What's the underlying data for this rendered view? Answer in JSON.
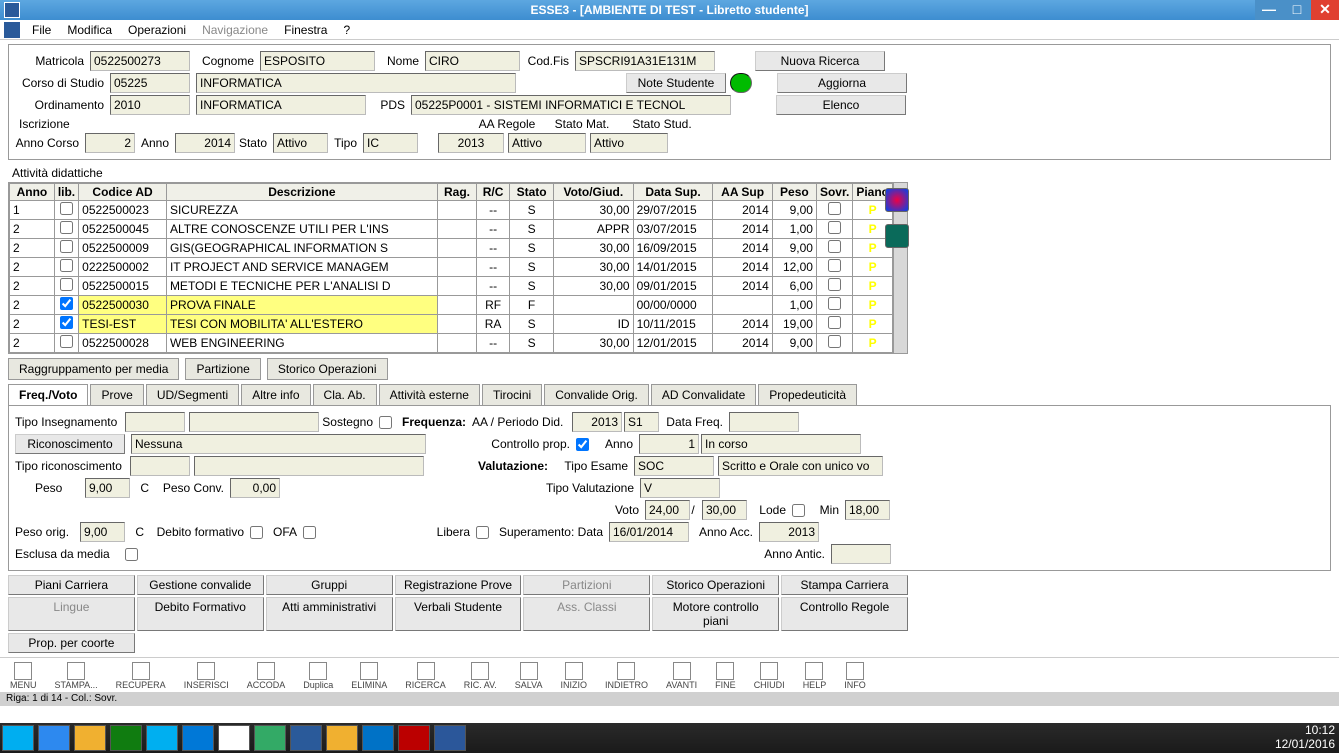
{
  "window": {
    "title": "ESSE3 - [AMBIENTE DI TEST - Libretto studente]"
  },
  "menu": {
    "file": "File",
    "modifica": "Modifica",
    "operazioni": "Operazioni",
    "navigazione": "Navigazione",
    "finestra": "Finestra",
    "help": "?"
  },
  "header": {
    "matricola_lbl": "Matricola",
    "matricola": "0522500273",
    "cognome_lbl": "Cognome",
    "cognome": "ESPOSITO",
    "nome_lbl": "Nome",
    "nome": "CIRO",
    "codfis_lbl": "Cod.Fis",
    "codfis": "SPSCRI91A31E131M",
    "corso_lbl": "Corso di Studio",
    "corso_cod": "05225",
    "corso_desc": "INFORMATICA",
    "note_btn": "Note Studente",
    "ord_lbl": "Ordinamento",
    "ord": "2010",
    "ord_desc": "INFORMATICA",
    "pds_lbl": "PDS",
    "pds": "05225P0001 - SISTEMI INFORMATICI E TECNOL",
    "iscr_lbl": "Iscrizione",
    "anno_corso_lbl": "Anno Corso",
    "anno_corso": "2",
    "anno_lbl": "Anno",
    "anno": "2014",
    "stato_lbl": "Stato",
    "stato": "Attivo",
    "tipo_lbl": "Tipo",
    "tipo": "IC",
    "aa_regole_lbl": "AA Regole",
    "aa_regole": "2013",
    "stato_mat_lbl": "Stato Mat.",
    "stato_mat": "Attivo",
    "stato_stud_lbl": "Stato Stud.",
    "stato_stud": "Attivo",
    "btn_ricerca": "Nuova Ricerca",
    "btn_aggiorna": "Aggiorna",
    "btn_elenco": "Elenco"
  },
  "grid": {
    "title": "Attività didattiche",
    "cols": {
      "anno": "Anno",
      "lib": "lib.",
      "codice": "Codice AD",
      "descr": "Descrizione",
      "rag": "Rag.",
      "rc": "R/C",
      "stato": "Stato",
      "voto": "Voto/Giud.",
      "data": "Data Sup.",
      "aasup": "AA Sup",
      "peso": "Peso",
      "sovr": "Sovr.",
      "piano": "Piano"
    },
    "rows": [
      {
        "anno": "1",
        "cb": false,
        "codice": "0522500023",
        "descr": "SICUREZZA",
        "rag": "",
        "rc": "--",
        "stato": "S",
        "voto": "30,00",
        "data": "29/07/2015",
        "aasup": "2014",
        "peso": "9,00",
        "hl": false
      },
      {
        "anno": "2",
        "cb": false,
        "codice": "0522500045",
        "descr": "ALTRE CONOSCENZE UTILI PER L'INS",
        "rag": "",
        "rc": "--",
        "stato": "S",
        "voto": "APPR",
        "data": "03/07/2015",
        "aasup": "2014",
        "peso": "1,00",
        "hl": false
      },
      {
        "anno": "2",
        "cb": false,
        "codice": "0522500009",
        "descr": "GIS(GEOGRAPHICAL INFORMATION S",
        "rag": "",
        "rc": "--",
        "stato": "S",
        "voto": "30,00",
        "data": "16/09/2015",
        "aasup": "2014",
        "peso": "9,00",
        "hl": false
      },
      {
        "anno": "2",
        "cb": false,
        "codice": "0222500002",
        "descr": "IT PROJECT AND SERVICE MANAGEM",
        "rag": "",
        "rc": "--",
        "stato": "S",
        "voto": "30,00",
        "data": "14/01/2015",
        "aasup": "2014",
        "peso": "12,00",
        "hl": false
      },
      {
        "anno": "2",
        "cb": false,
        "codice": "0522500015",
        "descr": "METODI E TECNICHE PER L'ANALISI D",
        "rag": "",
        "rc": "--",
        "stato": "S",
        "voto": "30,00",
        "data": "09/01/2015",
        "aasup": "2014",
        "peso": "6,00",
        "hl": false
      },
      {
        "anno": "2",
        "cb": true,
        "codice": "0522500030",
        "descr": "PROVA FINALE",
        "rag": "",
        "rc": "RF",
        "stato": "F",
        "voto": "",
        "data": "00/00/0000",
        "aasup": "",
        "peso": "1,00",
        "hl": true
      },
      {
        "anno": "2",
        "cb": true,
        "codice": "TESI-EST",
        "descr": "TESI CON MOBILITA' ALL'ESTERO",
        "rag": "",
        "rc": "RA",
        "stato": "S",
        "voto": "ID",
        "data": "10/11/2015",
        "aasup": "2014",
        "peso": "19,00",
        "hl": true
      },
      {
        "anno": "2",
        "cb": false,
        "codice": "0522500028",
        "descr": "WEB ENGINEERING",
        "rag": "",
        "rc": "--",
        "stato": "S",
        "voto": "30,00",
        "data": "12/01/2015",
        "aasup": "2014",
        "peso": "9,00",
        "hl": false
      }
    ]
  },
  "uptabs": {
    "ragg": "Raggruppamento per media",
    "part": "Partizione",
    "storico": "Storico Operazioni"
  },
  "tabs": {
    "freq": "Freq./Voto",
    "prove": "Prove",
    "ud": "UD/Segmenti",
    "altre": "Altre info",
    "cla": "Cla. Ab.",
    "att": "Attività esterne",
    "tiro": "Tirocini",
    "conv": "Convalide Orig.",
    "adconv": "AD Convalidate",
    "prop": "Propedeuticità"
  },
  "detail": {
    "tipo_ins_lbl": "Tipo Insegnamento",
    "sostegno_lbl": "Sostegno",
    "freq_lbl": "Frequenza:",
    "aa_periodo_lbl": "AA / Periodo Did.",
    "anno_freq": "2013",
    "sem": "S1",
    "data_freq_lbl": "Data Freq.",
    "ric_btn": "Riconoscimento",
    "ric_val": "Nessuna",
    "ctrl_prop_lbl": "Controllo prop.",
    "anno_lbl": "Anno",
    "anno_val": "1",
    "anno_desc": "In corso",
    "tipo_ric_lbl": "Tipo riconoscimento",
    "valut_lbl": "Valutazione:",
    "tipo_esame_lbl": "Tipo Esame",
    "tipo_esame": "SOC",
    "tipo_esame_desc": "Scritto e Orale con unico vo",
    "peso_lbl": "Peso",
    "peso": "9,00",
    "c_lbl": "C",
    "peso_conv_lbl": "Peso Conv.",
    "peso_conv": "0,00",
    "tipo_val_lbl": "Tipo Valutazione",
    "tipo_val": "V",
    "voto_lbl": "Voto",
    "voto": "24,00",
    "slash": "/",
    "voto_max": "30,00",
    "lode_lbl": "Lode",
    "min_lbl": "Min",
    "min": "18,00",
    "peso_orig_lbl": "Peso orig.",
    "peso_orig": "9,00",
    "deb_lbl": "Debito formativo",
    "ofa_lbl": "OFA",
    "libera_lbl": "Libera",
    "sup_lbl": "Superamento: Data",
    "sup_data": "16/01/2014",
    "anno_acc_lbl": "Anno Acc.",
    "anno_acc": "2013",
    "esclusa_lbl": "Esclusa da media",
    "anno_antic_lbl": "Anno Antic."
  },
  "bbtns": {
    "piani": "Piani Carriera",
    "gest": "Gestione convalide",
    "gruppi": "Gruppi",
    "reg": "Registrazione Prove",
    "part": "Partizioni",
    "storico": "Storico Operazioni",
    "stampa": "Stampa Carriera",
    "lingue": "Lingue",
    "deb": "Debito Formativo",
    "atti": "Atti amministrativi",
    "verb": "Verbali Studente",
    "ass": "Ass. Classi",
    "motore": "Motore controllo piani",
    "ctrl": "Controllo Regole",
    "coorte": "Prop. per coorte"
  },
  "toolbar": {
    "menu": "MENU",
    "stampa": "STAMPA...",
    "recupera": "RECUPERA",
    "inserisci": "INSERISCI",
    "accoda": "ACCODA",
    "duplica": "Duplica",
    "elimina": "ELIMINA",
    "ricerca": "RICERCA",
    "ricav": "RIC. AV.",
    "salva": "SALVA",
    "inizio": "INIZIO",
    "indietro": "INDIETRO",
    "avanti": "AVANTI",
    "fine": "FINE",
    "chiudi": "CHIUDI",
    "help": "HELP",
    "info": "INFO"
  },
  "status": "Riga: 1 di 14 - Col.: Sovr.",
  "clock": {
    "time": "10:12",
    "date": "12/01/2016"
  }
}
